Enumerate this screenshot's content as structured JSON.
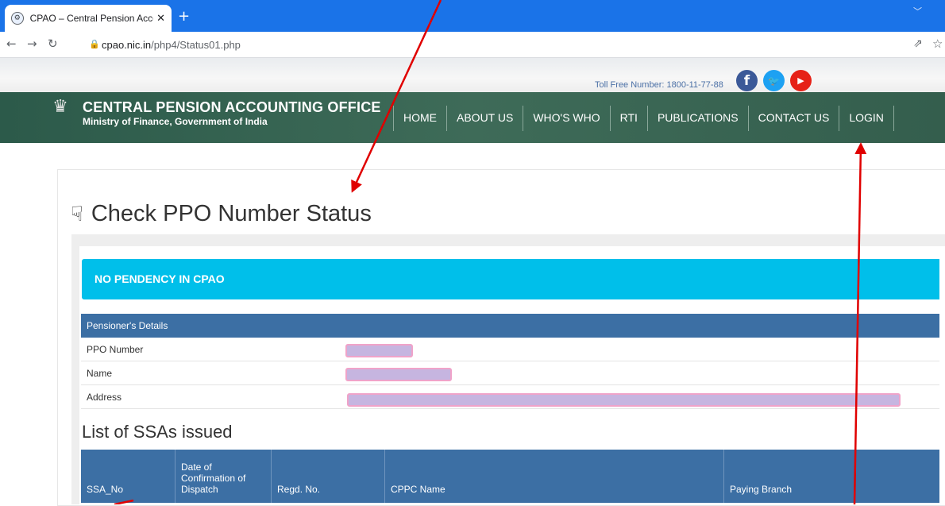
{
  "browser": {
    "tab_title": "CPAO – Central Pension Accounti",
    "tab_close": "✕",
    "new_tab": "+",
    "url_domain": "cpao.nic.in",
    "url_path": "/php4/Status01.php"
  },
  "site": {
    "toll_free": "Toll Free Number: 1800-11-77-88",
    "org_name": "CENTRAL PENSION ACCOUNTING OFFICE",
    "org_sub": "Ministry of Finance, Government of India",
    "nav": [
      {
        "label": "HOME"
      },
      {
        "label": "ABOUT US"
      },
      {
        "label": "WHO'S WHO"
      },
      {
        "label": "RTI"
      },
      {
        "label": "PUBLICATIONS"
      },
      {
        "label": "CONTACT US"
      },
      {
        "label": "LOGIN"
      }
    ],
    "social": {
      "facebook": "f",
      "twitter": "🐦",
      "youtube": "▶"
    }
  },
  "page": {
    "title": "Check PPO Number Status",
    "alert": "NO PENDENCY IN CPAO",
    "details_header": "Pensioner's Details",
    "details_rows": [
      {
        "label": "PPO Number"
      },
      {
        "label": "Name"
      },
      {
        "label": "Address"
      }
    ],
    "list_title": "List of SSAs issued",
    "ssa_columns": [
      "SSA_No",
      "Date of Confirmation of Dispatch",
      "Regd. No.",
      "CPPC Name",
      "Paying Branch"
    ]
  },
  "colors": {
    "tabbar": "#1a73e8",
    "navband": "#3e6b58",
    "alert": "#00bfea",
    "table_header": "#3c6fa4",
    "annotation": "#e00000"
  }
}
